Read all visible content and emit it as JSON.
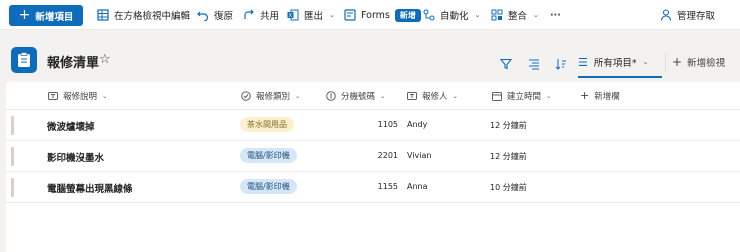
{
  "toolbar": {
    "new_item": "新增項目",
    "edit_grid": "在方格檢視中編輯",
    "undo": "復原",
    "share": "共用",
    "export": "匯出",
    "forms": "Forms",
    "forms_badge": "新增",
    "automate": "自動化",
    "integrate": "整合",
    "more": "···",
    "manage_access": "管理存取"
  },
  "header": {
    "list_title": "報修清單",
    "view_name": "所有項目*",
    "add_view": "新增檢視"
  },
  "columns": {
    "description": "報修說明",
    "category": "報修類別",
    "extension": "分機號碼",
    "reporter": "報修人",
    "created": "建立時間",
    "add_column": "新增欄"
  },
  "rows": [
    {
      "title": "微波爐壞掉",
      "category": "茶水間用品",
      "extension": "1105",
      "reporter": "Andy",
      "created": "12 分鐘前"
    },
    {
      "title": "影印機沒墨水",
      "category": "電腦/影印機",
      "extension": "2201",
      "reporter": "Vivian",
      "created": "12 分鐘前"
    },
    {
      "title": "電腦螢幕出現黑線條",
      "category": "電腦/影印機",
      "extension": "1155",
      "reporter": "Anna",
      "created": "10 分鐘前"
    }
  ],
  "category_colors": {
    "茶水間用品": {
      "bg": "#fdf0d0",
      "fg": "#8a6a1f"
    },
    "電腦/影印機": {
      "bg": "#d5e7f7",
      "fg": "#1c4f7d"
    }
  },
  "accent": "#0f6cbd"
}
